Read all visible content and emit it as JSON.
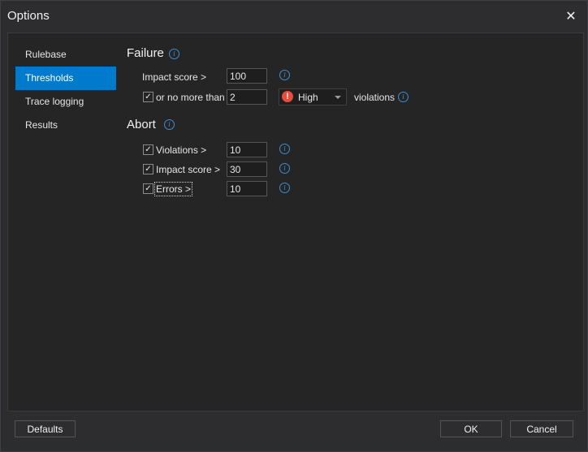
{
  "window": {
    "title": "Options"
  },
  "sidebar": {
    "items": [
      {
        "label": "Rulebase"
      },
      {
        "label": "Thresholds"
      },
      {
        "label": "Trace logging"
      },
      {
        "label": "Results"
      }
    ]
  },
  "failure": {
    "title": "Failure",
    "impact_label": "Impact score >",
    "impact_value": "100",
    "or_no_more_label": "or no more than",
    "or_no_more_value": "2",
    "severity_selected": "High",
    "violations_suffix": "violations"
  },
  "abort": {
    "title": "Abort",
    "violations_label": "Violations >",
    "violations_value": "10",
    "impact_label": "Impact score >",
    "impact_value": "30",
    "errors_label": "Errors >",
    "errors_value": "10"
  },
  "footer": {
    "defaults_label": "Defaults",
    "ok_label": "OK",
    "cancel_label": "Cancel"
  },
  "icons": {
    "info": "info-icon",
    "check": "check-icon",
    "severity": "exclamation-icon"
  },
  "colors": {
    "accent": "#007acc",
    "severity_high": "#e74c3c",
    "info": "#3e8ed0"
  }
}
